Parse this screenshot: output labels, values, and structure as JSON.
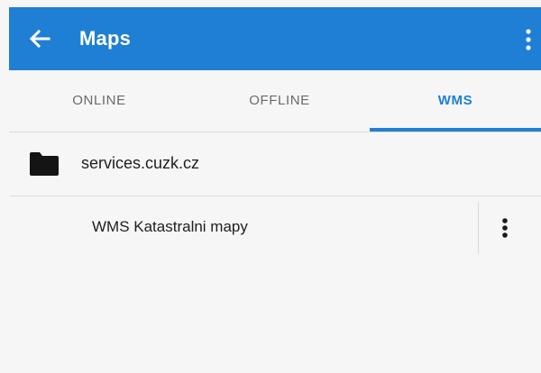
{
  "appbar": {
    "title": "Maps",
    "back_icon": "arrow-left-icon",
    "overflow_icon": "more-vertical-icon",
    "color": "#1f7fd4"
  },
  "tabs": [
    {
      "label": "ONLINE",
      "selected": false
    },
    {
      "label": "OFFLINE",
      "selected": false
    },
    {
      "label": "WMS",
      "selected": true
    }
  ],
  "list": {
    "folder": {
      "icon": "folder-icon",
      "label": "services.cuzk.cz"
    },
    "items": [
      {
        "label": "WMS Katastralni mapy",
        "menu_icon": "more-vertical-icon"
      }
    ]
  }
}
